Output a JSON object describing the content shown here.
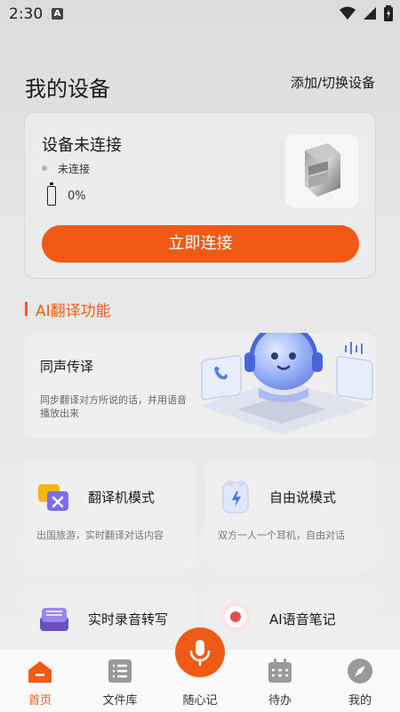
{
  "status_bar": {
    "time": "2:30",
    "indicator": "A"
  },
  "header": {
    "title": "我的设备",
    "switch_link": "添加/切换设备"
  },
  "device_card": {
    "status_title": "设备未连接",
    "connection_text": "未连接",
    "battery_text": "0%",
    "battery_level": 0,
    "connect_button": "立即连接"
  },
  "section": {
    "title": "AI翻译功能"
  },
  "simultaneous": {
    "title": "同声传译",
    "desc": "同步翻译对方所说的话，并用语音播放出来"
  },
  "features": [
    {
      "title": "翻译机模式",
      "desc": "出国旅游，实时翻译对话内容",
      "icon": "translator-icon"
    },
    {
      "title": "自由说模式",
      "desc": "双方一人一个耳机，自由对话",
      "icon": "earbuds-icon"
    },
    {
      "title": "实时录音转写",
      "desc": "",
      "icon": "recorder-icon"
    },
    {
      "title": "AI语音笔记",
      "desc": "",
      "icon": "record-dot-icon"
    }
  ],
  "tabs": [
    {
      "label": "首页",
      "icon": "home-icon"
    },
    {
      "label": "文件库",
      "icon": "list-icon"
    },
    {
      "label": "随心记",
      "icon": "mic-icon"
    },
    {
      "label": "待办",
      "icon": "calendar-icon"
    },
    {
      "label": "我的",
      "icon": "compass-icon"
    }
  ],
  "colors": {
    "accent": "#f05a14",
    "active_tab": "#f05a14"
  }
}
